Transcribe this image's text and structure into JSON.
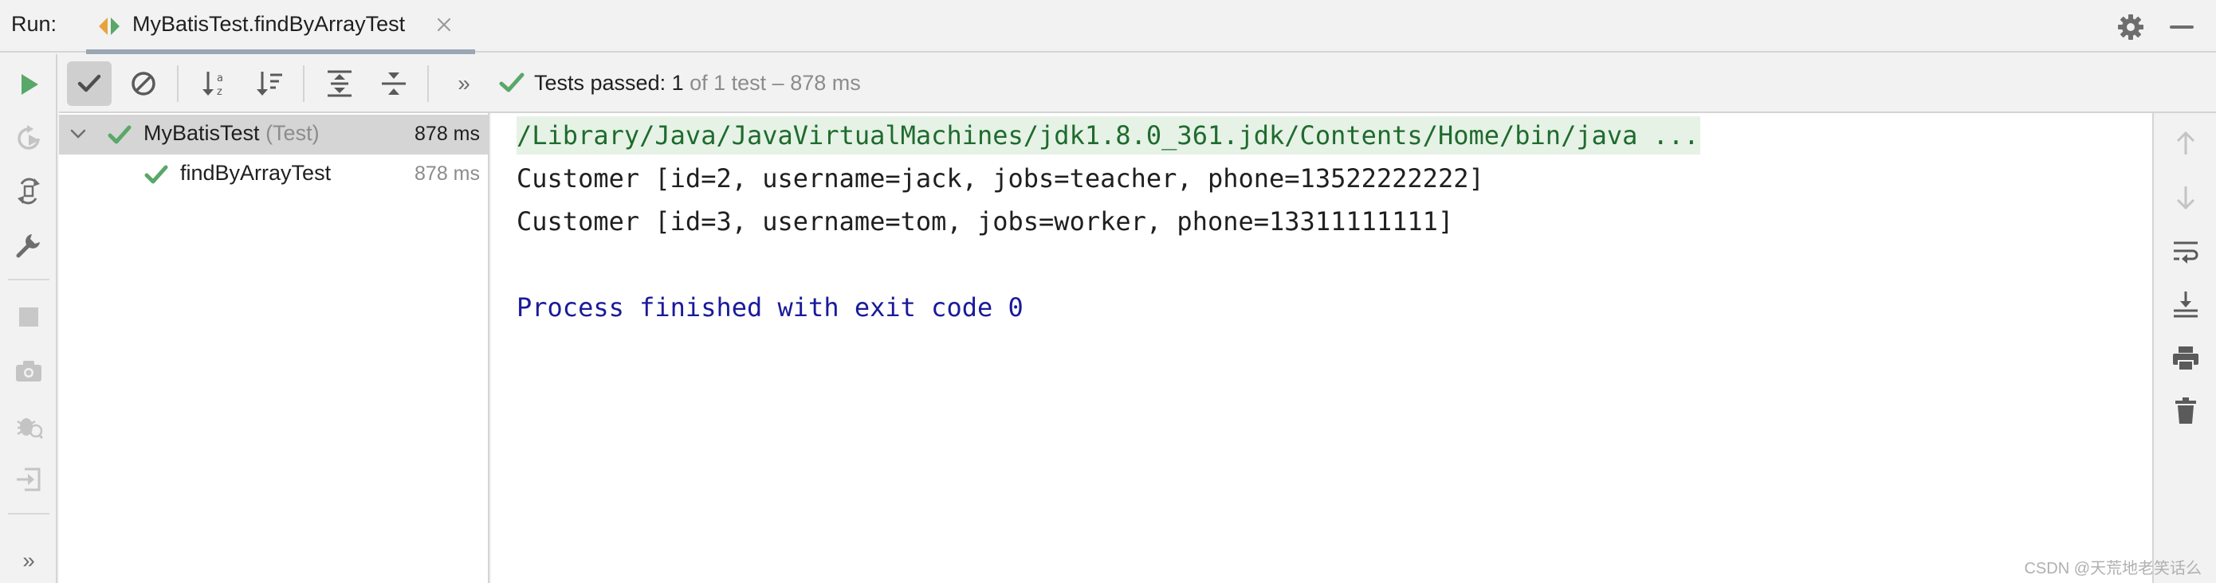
{
  "header": {
    "run_label": "Run:",
    "tab_title": "MyBatisTest.findByArrayTest"
  },
  "toolbar": {
    "status_prefix": "Tests passed: ",
    "status_count": "1",
    "status_suffix": " of 1 test – 878 ms",
    "more_label": "»"
  },
  "tree": {
    "items": [
      {
        "label": "MyBatisTest",
        "kind": "(Test)",
        "time": "878 ms",
        "status": "passed",
        "expanded": true
      },
      {
        "label": "findByArrayTest",
        "time": "878 ms",
        "status": "passed"
      }
    ]
  },
  "console": {
    "lines": [
      "/Library/Java/JavaVirtualMachines/jdk1.8.0_361.jdk/Contents/Home/bin/java ...",
      "Customer [id=2, username=jack, jobs=teacher, phone=13522222222]",
      "Customer [id=3, username=tom, jobs=worker, phone=13311111111]",
      "Process finished with exit code 0"
    ]
  },
  "left_toolbar": {
    "more_label": "»"
  },
  "watermark": "CSDN @天荒地老笑话么",
  "colors": {
    "passed": "#59a869",
    "run": "#59a869",
    "exit_text": "#1a1a9a",
    "cmd_text": "#1f6b2e",
    "cmd_bg": "#e6f2e6"
  }
}
